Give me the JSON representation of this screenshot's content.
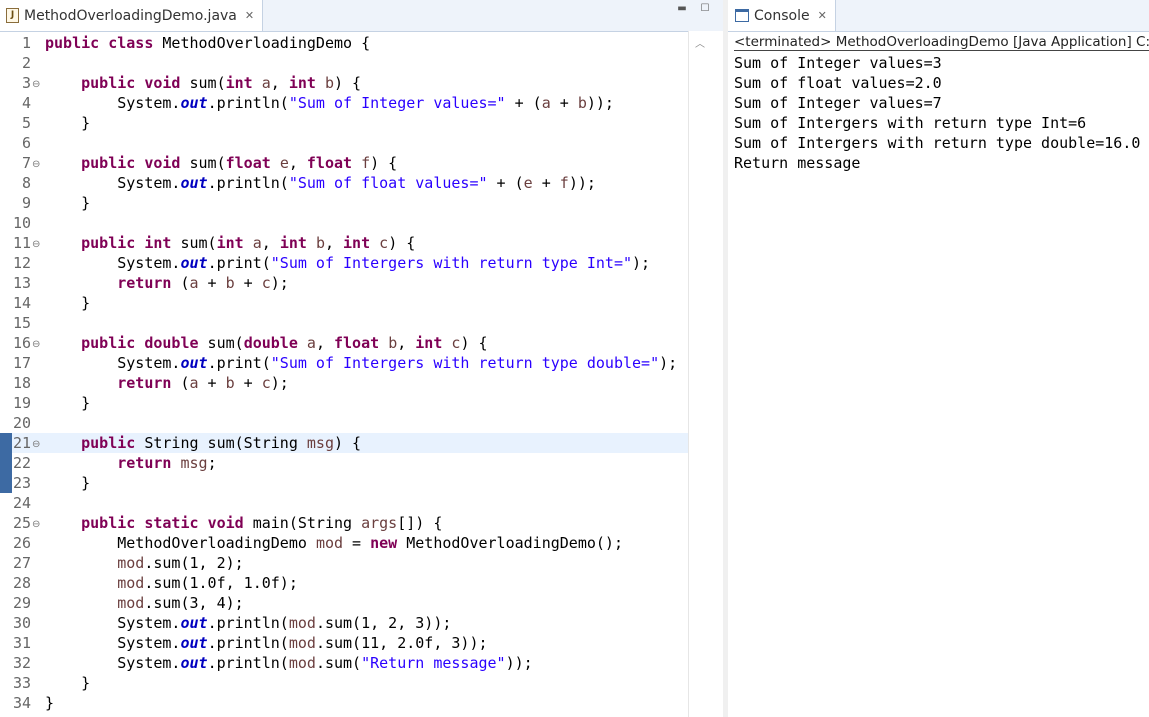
{
  "editor": {
    "tab_title": "MethodOverloadingDemo.java",
    "tab_file_icon": "java-file-icon",
    "tab_close_icon": "close-icon",
    "minimize_icon": "minimize-icon",
    "maximize_icon": "maximize-icon",
    "current_line": 21,
    "lines": [
      {
        "n": "1",
        "fold": "",
        "tokens": [
          {
            "t": "k",
            "v": "public"
          },
          {
            "t": "p",
            "v": " "
          },
          {
            "t": "k",
            "v": "class"
          },
          {
            "t": "p",
            "v": " MethodOverloadingDemo {"
          }
        ]
      },
      {
        "n": "2",
        "fold": "",
        "tokens": []
      },
      {
        "n": "3",
        "fold": "⊖",
        "tokens": [
          {
            "t": "p",
            "v": "    "
          },
          {
            "t": "k",
            "v": "public"
          },
          {
            "t": "p",
            "v": " "
          },
          {
            "t": "k",
            "v": "void"
          },
          {
            "t": "p",
            "v": " sum("
          },
          {
            "t": "k",
            "v": "int"
          },
          {
            "t": "p",
            "v": " "
          },
          {
            "t": "a",
            "v": "a"
          },
          {
            "t": "p",
            "v": ", "
          },
          {
            "t": "k",
            "v": "int"
          },
          {
            "t": "p",
            "v": " "
          },
          {
            "t": "a",
            "v": "b"
          },
          {
            "t": "p",
            "v": ") {"
          }
        ]
      },
      {
        "n": "4",
        "fold": "",
        "tokens": [
          {
            "t": "p",
            "v": "        System."
          },
          {
            "t": "f",
            "v": "out"
          },
          {
            "t": "p",
            "v": ".println("
          },
          {
            "t": "s",
            "v": "\"Sum of Integer values=\""
          },
          {
            "t": "p",
            "v": " + ("
          },
          {
            "t": "a",
            "v": "a"
          },
          {
            "t": "p",
            "v": " + "
          },
          {
            "t": "a",
            "v": "b"
          },
          {
            "t": "p",
            "v": "));"
          }
        ]
      },
      {
        "n": "5",
        "fold": "",
        "tokens": [
          {
            "t": "p",
            "v": "    }"
          }
        ]
      },
      {
        "n": "6",
        "fold": "",
        "tokens": []
      },
      {
        "n": "7",
        "fold": "⊖",
        "tokens": [
          {
            "t": "p",
            "v": "    "
          },
          {
            "t": "k",
            "v": "public"
          },
          {
            "t": "p",
            "v": " "
          },
          {
            "t": "k",
            "v": "void"
          },
          {
            "t": "p",
            "v": " sum("
          },
          {
            "t": "k",
            "v": "float"
          },
          {
            "t": "p",
            "v": " "
          },
          {
            "t": "a",
            "v": "e"
          },
          {
            "t": "p",
            "v": ", "
          },
          {
            "t": "k",
            "v": "float"
          },
          {
            "t": "p",
            "v": " "
          },
          {
            "t": "a",
            "v": "f"
          },
          {
            "t": "p",
            "v": ") {"
          }
        ]
      },
      {
        "n": "8",
        "fold": "",
        "tokens": [
          {
            "t": "p",
            "v": "        System."
          },
          {
            "t": "f",
            "v": "out"
          },
          {
            "t": "p",
            "v": ".println("
          },
          {
            "t": "s",
            "v": "\"Sum of float values=\""
          },
          {
            "t": "p",
            "v": " + ("
          },
          {
            "t": "a",
            "v": "e"
          },
          {
            "t": "p",
            "v": " + "
          },
          {
            "t": "a",
            "v": "f"
          },
          {
            "t": "p",
            "v": "));"
          }
        ]
      },
      {
        "n": "9",
        "fold": "",
        "tokens": [
          {
            "t": "p",
            "v": "    }"
          }
        ]
      },
      {
        "n": "10",
        "fold": "",
        "tokens": []
      },
      {
        "n": "11",
        "fold": "⊖",
        "tokens": [
          {
            "t": "p",
            "v": "    "
          },
          {
            "t": "k",
            "v": "public"
          },
          {
            "t": "p",
            "v": " "
          },
          {
            "t": "k",
            "v": "int"
          },
          {
            "t": "p",
            "v": " sum("
          },
          {
            "t": "k",
            "v": "int"
          },
          {
            "t": "p",
            "v": " "
          },
          {
            "t": "a",
            "v": "a"
          },
          {
            "t": "p",
            "v": ", "
          },
          {
            "t": "k",
            "v": "int"
          },
          {
            "t": "p",
            "v": " "
          },
          {
            "t": "a",
            "v": "b"
          },
          {
            "t": "p",
            "v": ", "
          },
          {
            "t": "k",
            "v": "int"
          },
          {
            "t": "p",
            "v": " "
          },
          {
            "t": "a",
            "v": "c"
          },
          {
            "t": "p",
            "v": ") {"
          }
        ]
      },
      {
        "n": "12",
        "fold": "",
        "tokens": [
          {
            "t": "p",
            "v": "        System."
          },
          {
            "t": "f",
            "v": "out"
          },
          {
            "t": "p",
            "v": ".print("
          },
          {
            "t": "s",
            "v": "\"Sum of Intergers with return type Int=\""
          },
          {
            "t": "p",
            "v": ");"
          }
        ]
      },
      {
        "n": "13",
        "fold": "",
        "tokens": [
          {
            "t": "p",
            "v": "        "
          },
          {
            "t": "k",
            "v": "return"
          },
          {
            "t": "p",
            "v": " ("
          },
          {
            "t": "a",
            "v": "a"
          },
          {
            "t": "p",
            "v": " + "
          },
          {
            "t": "a",
            "v": "b"
          },
          {
            "t": "p",
            "v": " + "
          },
          {
            "t": "a",
            "v": "c"
          },
          {
            "t": "p",
            "v": ");"
          }
        ]
      },
      {
        "n": "14",
        "fold": "",
        "tokens": [
          {
            "t": "p",
            "v": "    }"
          }
        ]
      },
      {
        "n": "15",
        "fold": "",
        "tokens": []
      },
      {
        "n": "16",
        "fold": "⊖",
        "tokens": [
          {
            "t": "p",
            "v": "    "
          },
          {
            "t": "k",
            "v": "public"
          },
          {
            "t": "p",
            "v": " "
          },
          {
            "t": "k",
            "v": "double"
          },
          {
            "t": "p",
            "v": " sum("
          },
          {
            "t": "k",
            "v": "double"
          },
          {
            "t": "p",
            "v": " "
          },
          {
            "t": "a",
            "v": "a"
          },
          {
            "t": "p",
            "v": ", "
          },
          {
            "t": "k",
            "v": "float"
          },
          {
            "t": "p",
            "v": " "
          },
          {
            "t": "a",
            "v": "b"
          },
          {
            "t": "p",
            "v": ", "
          },
          {
            "t": "k",
            "v": "int"
          },
          {
            "t": "p",
            "v": " "
          },
          {
            "t": "a",
            "v": "c"
          },
          {
            "t": "p",
            "v": ") {"
          }
        ]
      },
      {
        "n": "17",
        "fold": "",
        "tokens": [
          {
            "t": "p",
            "v": "        System."
          },
          {
            "t": "f",
            "v": "out"
          },
          {
            "t": "p",
            "v": ".print("
          },
          {
            "t": "s",
            "v": "\"Sum of Intergers with return type double=\""
          },
          {
            "t": "p",
            "v": ");"
          }
        ]
      },
      {
        "n": "18",
        "fold": "",
        "tokens": [
          {
            "t": "p",
            "v": "        "
          },
          {
            "t": "k",
            "v": "return"
          },
          {
            "t": "p",
            "v": " ("
          },
          {
            "t": "a",
            "v": "a"
          },
          {
            "t": "p",
            "v": " + "
          },
          {
            "t": "a",
            "v": "b"
          },
          {
            "t": "p",
            "v": " + "
          },
          {
            "t": "a",
            "v": "c"
          },
          {
            "t": "p",
            "v": ");"
          }
        ]
      },
      {
        "n": "19",
        "fold": "",
        "tokens": [
          {
            "t": "p",
            "v": "    }"
          }
        ]
      },
      {
        "n": "20",
        "fold": "",
        "tokens": []
      },
      {
        "n": "21",
        "fold": "⊖",
        "tokens": [
          {
            "t": "p",
            "v": "    "
          },
          {
            "t": "k",
            "v": "public"
          },
          {
            "t": "p",
            "v": " String sum(String "
          },
          {
            "t": "a",
            "v": "msg"
          },
          {
            "t": "p",
            "v": ") {"
          }
        ]
      },
      {
        "n": "22",
        "fold": "",
        "tokens": [
          {
            "t": "p",
            "v": "        "
          },
          {
            "t": "k",
            "v": "return"
          },
          {
            "t": "p",
            "v": " "
          },
          {
            "t": "a",
            "v": "msg"
          },
          {
            "t": "p",
            "v": ";"
          }
        ]
      },
      {
        "n": "23",
        "fold": "",
        "tokens": [
          {
            "t": "p",
            "v": "    }"
          }
        ]
      },
      {
        "n": "24",
        "fold": "",
        "tokens": []
      },
      {
        "n": "25",
        "fold": "⊖",
        "tokens": [
          {
            "t": "p",
            "v": "    "
          },
          {
            "t": "k",
            "v": "public"
          },
          {
            "t": "p",
            "v": " "
          },
          {
            "t": "k",
            "v": "static"
          },
          {
            "t": "p",
            "v": " "
          },
          {
            "t": "k",
            "v": "void"
          },
          {
            "t": "p",
            "v": " main(String "
          },
          {
            "t": "a",
            "v": "args"
          },
          {
            "t": "p",
            "v": "[]) {"
          }
        ]
      },
      {
        "n": "26",
        "fold": "",
        "tokens": [
          {
            "t": "p",
            "v": "        MethodOverloadingDemo "
          },
          {
            "t": "a",
            "v": "mod"
          },
          {
            "t": "p",
            "v": " = "
          },
          {
            "t": "k",
            "v": "new"
          },
          {
            "t": "p",
            "v": " MethodOverloadingDemo();"
          }
        ]
      },
      {
        "n": "27",
        "fold": "",
        "tokens": [
          {
            "t": "p",
            "v": "        "
          },
          {
            "t": "a",
            "v": "mod"
          },
          {
            "t": "p",
            "v": ".sum(1, 2);"
          }
        ]
      },
      {
        "n": "28",
        "fold": "",
        "tokens": [
          {
            "t": "p",
            "v": "        "
          },
          {
            "t": "a",
            "v": "mod"
          },
          {
            "t": "p",
            "v": ".sum(1.0f, 1.0f);"
          }
        ]
      },
      {
        "n": "29",
        "fold": "",
        "tokens": [
          {
            "t": "p",
            "v": "        "
          },
          {
            "t": "a",
            "v": "mod"
          },
          {
            "t": "p",
            "v": ".sum(3, 4);"
          }
        ]
      },
      {
        "n": "30",
        "fold": "",
        "tokens": [
          {
            "t": "p",
            "v": "        System."
          },
          {
            "t": "f",
            "v": "out"
          },
          {
            "t": "p",
            "v": ".println("
          },
          {
            "t": "a",
            "v": "mod"
          },
          {
            "t": "p",
            "v": ".sum(1, 2, 3));"
          }
        ]
      },
      {
        "n": "31",
        "fold": "",
        "tokens": [
          {
            "t": "p",
            "v": "        System."
          },
          {
            "t": "f",
            "v": "out"
          },
          {
            "t": "p",
            "v": ".println("
          },
          {
            "t": "a",
            "v": "mod"
          },
          {
            "t": "p",
            "v": ".sum(11, 2.0f, 3));"
          }
        ]
      },
      {
        "n": "32",
        "fold": "",
        "tokens": [
          {
            "t": "p",
            "v": "        System."
          },
          {
            "t": "f",
            "v": "out"
          },
          {
            "t": "p",
            "v": ".println("
          },
          {
            "t": "a",
            "v": "mod"
          },
          {
            "t": "p",
            "v": ".sum("
          },
          {
            "t": "s",
            "v": "\"Return message\""
          },
          {
            "t": "p",
            "v": "));"
          }
        ]
      },
      {
        "n": "33",
        "fold": "",
        "tokens": [
          {
            "t": "p",
            "v": "    }"
          }
        ]
      },
      {
        "n": "34",
        "fold": "",
        "tokens": [
          {
            "t": "p",
            "v": "}"
          }
        ]
      }
    ]
  },
  "console": {
    "tab_title": "Console",
    "tab_icon": "console-icon",
    "tab_close_icon": "close-icon",
    "header": "<terminated> MethodOverloadingDemo [Java Application] C:\\",
    "output": [
      "Sum of Integer values=3",
      "Sum of float values=2.0",
      "Sum of Integer values=7",
      "Sum of Intergers with return type Int=6",
      "Sum of Intergers with return type double=16.0",
      "Return message"
    ]
  },
  "colors": {
    "keyword": "#7f0055",
    "string": "#2a00ff",
    "static_field": "#0000c0",
    "local_variable": "#6a3e3e",
    "current_line_bg": "#e8f2fe",
    "tab_bar_bg": "#eef3fa"
  }
}
